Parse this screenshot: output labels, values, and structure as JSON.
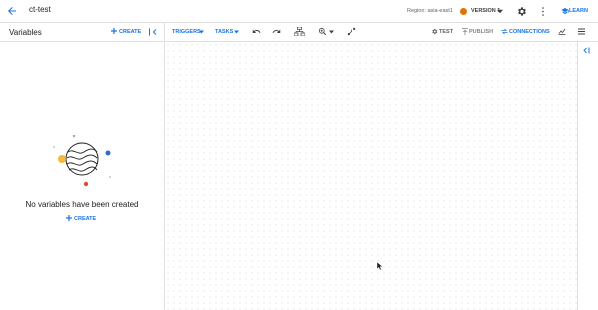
{
  "header": {
    "title": "ct-test",
    "region_label": "Region: asia-east1",
    "version_label": "VERSION 1",
    "learn_label": "LEARN"
  },
  "variables_panel": {
    "title": "Variables",
    "create_label": "CREATE",
    "empty_message": "No variables have been created",
    "empty_create_label": "CREATE"
  },
  "toolbar": {
    "triggers_label": "TRIGGERS",
    "tasks_label": "TASKS",
    "test_label": "TEST",
    "publish_label": "PUBLISH",
    "connections_label": "CONNECTIONS"
  },
  "colors": {
    "accent": "#1a73e8",
    "version_dot": "#e37400",
    "border": "#e0e0e0"
  }
}
